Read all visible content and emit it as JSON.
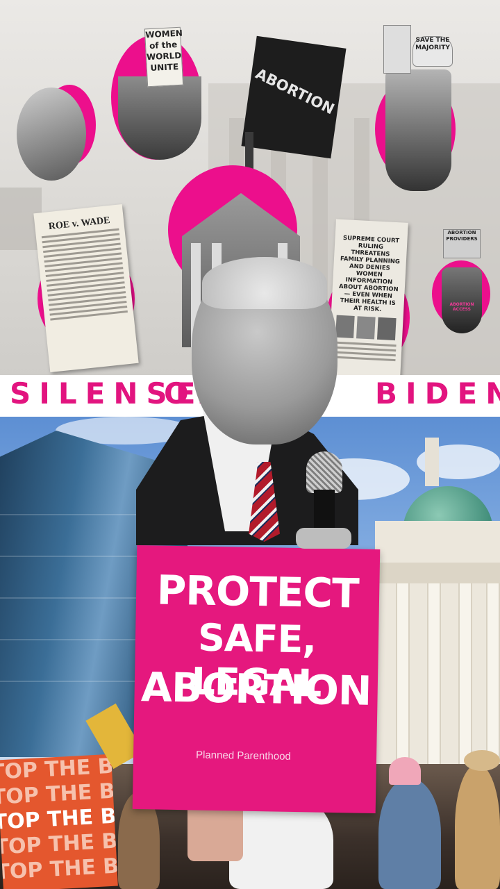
{
  "title": {
    "word1": "SILENSE",
    "word2": "OF",
    "word3": "BIDEN"
  },
  "collage": {
    "sign_women_line1": "WOMEN",
    "sign_women_line2": "of the",
    "sign_women_line3": "WORLD",
    "sign_women_line4": "UNITE",
    "flag_text": "ABORTION",
    "doc_title": "ROE v. WADE",
    "news_headline": "SUPREME COURT RULING THREATENS FAMILY PLANNING AND DENIES WOMEN INFORMATION ABOUT ABORTION — EVEN WHEN THEIR HEALTH IS AT RISK.",
    "sign_majority": "SAVE THE MAJORITY",
    "sign_providers": "ABORTION PROVIDERS",
    "shirt_access": "ABORTION ACCESS"
  },
  "protest": {
    "pink_sign_line1": "PROTECT",
    "pink_sign_line2": "SAFE, LEGAL",
    "pink_sign_line3": "ABORTION",
    "pink_sign_brand": "Planned Parenthood",
    "orange_sign_line": "TOP THE BANS"
  },
  "colors": {
    "accent_pink": "#e2147f",
    "sign_pink": "#e5187e",
    "orange": "#e4572e"
  }
}
